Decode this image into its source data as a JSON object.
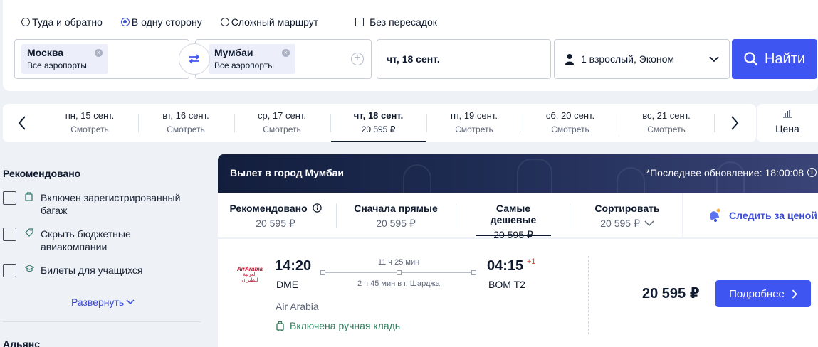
{
  "trip_types": {
    "round_trip": "Туда и обратно",
    "one_way": "В одну сторону",
    "multi_city": "Сложный маршрут",
    "nonstop": "Без пересадок"
  },
  "search": {
    "from_city": "Москва",
    "from_sub": "Все аэропорты",
    "to_city": "Мумбаи",
    "to_sub": "Все аэропорты",
    "date": "чт, 18 сент.",
    "passengers": "1 взрослый, Эконом",
    "find_label": "Найти"
  },
  "dates": [
    {
      "day": "пн, 15 сент.",
      "price": "Смотреть"
    },
    {
      "day": "вт, 16 сент.",
      "price": "Смотреть"
    },
    {
      "day": "ср, 17 сент.",
      "price": "Смотреть"
    },
    {
      "day": "чт, 18 сент.",
      "price": "20 595 ₽"
    },
    {
      "day": "пт, 19 сент.",
      "price": "Смотреть"
    },
    {
      "day": "сб, 20 сент.",
      "price": "Смотреть"
    },
    {
      "day": "вс, 21 сент.",
      "price": "Смотреть"
    }
  ],
  "price_tab_label": "Цена",
  "filters": {
    "heading": "Рекомендовано",
    "items": [
      {
        "label": "Включен зарегистрированный багаж"
      },
      {
        "label": "Скрыть бюджетные авиакомпании"
      },
      {
        "label": "Билеты для учащихся"
      }
    ],
    "expand": "Развернуть",
    "alliance": "Альянс"
  },
  "results": {
    "title": "Вылет в город Мумбаи",
    "updated": "*Последнее обновление: 18:00:08"
  },
  "sort_tabs": [
    {
      "title": "Рекомендовано",
      "value": "20 595 ₽"
    },
    {
      "title": "Сначала прямые",
      "value": "20 595 ₽"
    },
    {
      "title": "Самые дешевые",
      "value": "20 595 ₽"
    },
    {
      "title": "Сортировать",
      "value": "20 595 ₽"
    }
  ],
  "watch_price": "Следить за ценой",
  "ticket": {
    "logo_en": "AirArabia",
    "logo_ar": "العربية للطيران",
    "dep_time": "14:20",
    "dep_code": "DME",
    "total_duration": "11 ч 25 мин",
    "layover": "2 ч 45 мин в г. Шарджа",
    "arr_time": "04:15",
    "day_shift": "+1",
    "arr_code": "BOM T2",
    "airline": "Air Arabia",
    "baggage": "Включена ручная кладь",
    "price": "20 595 ₽",
    "details": "Подробнее"
  },
  "colors": {
    "accent": "#3f55f2",
    "link": "#3a4bd8",
    "header_bg": "#131e3d",
    "baggage_green": "#2e7d5b"
  }
}
